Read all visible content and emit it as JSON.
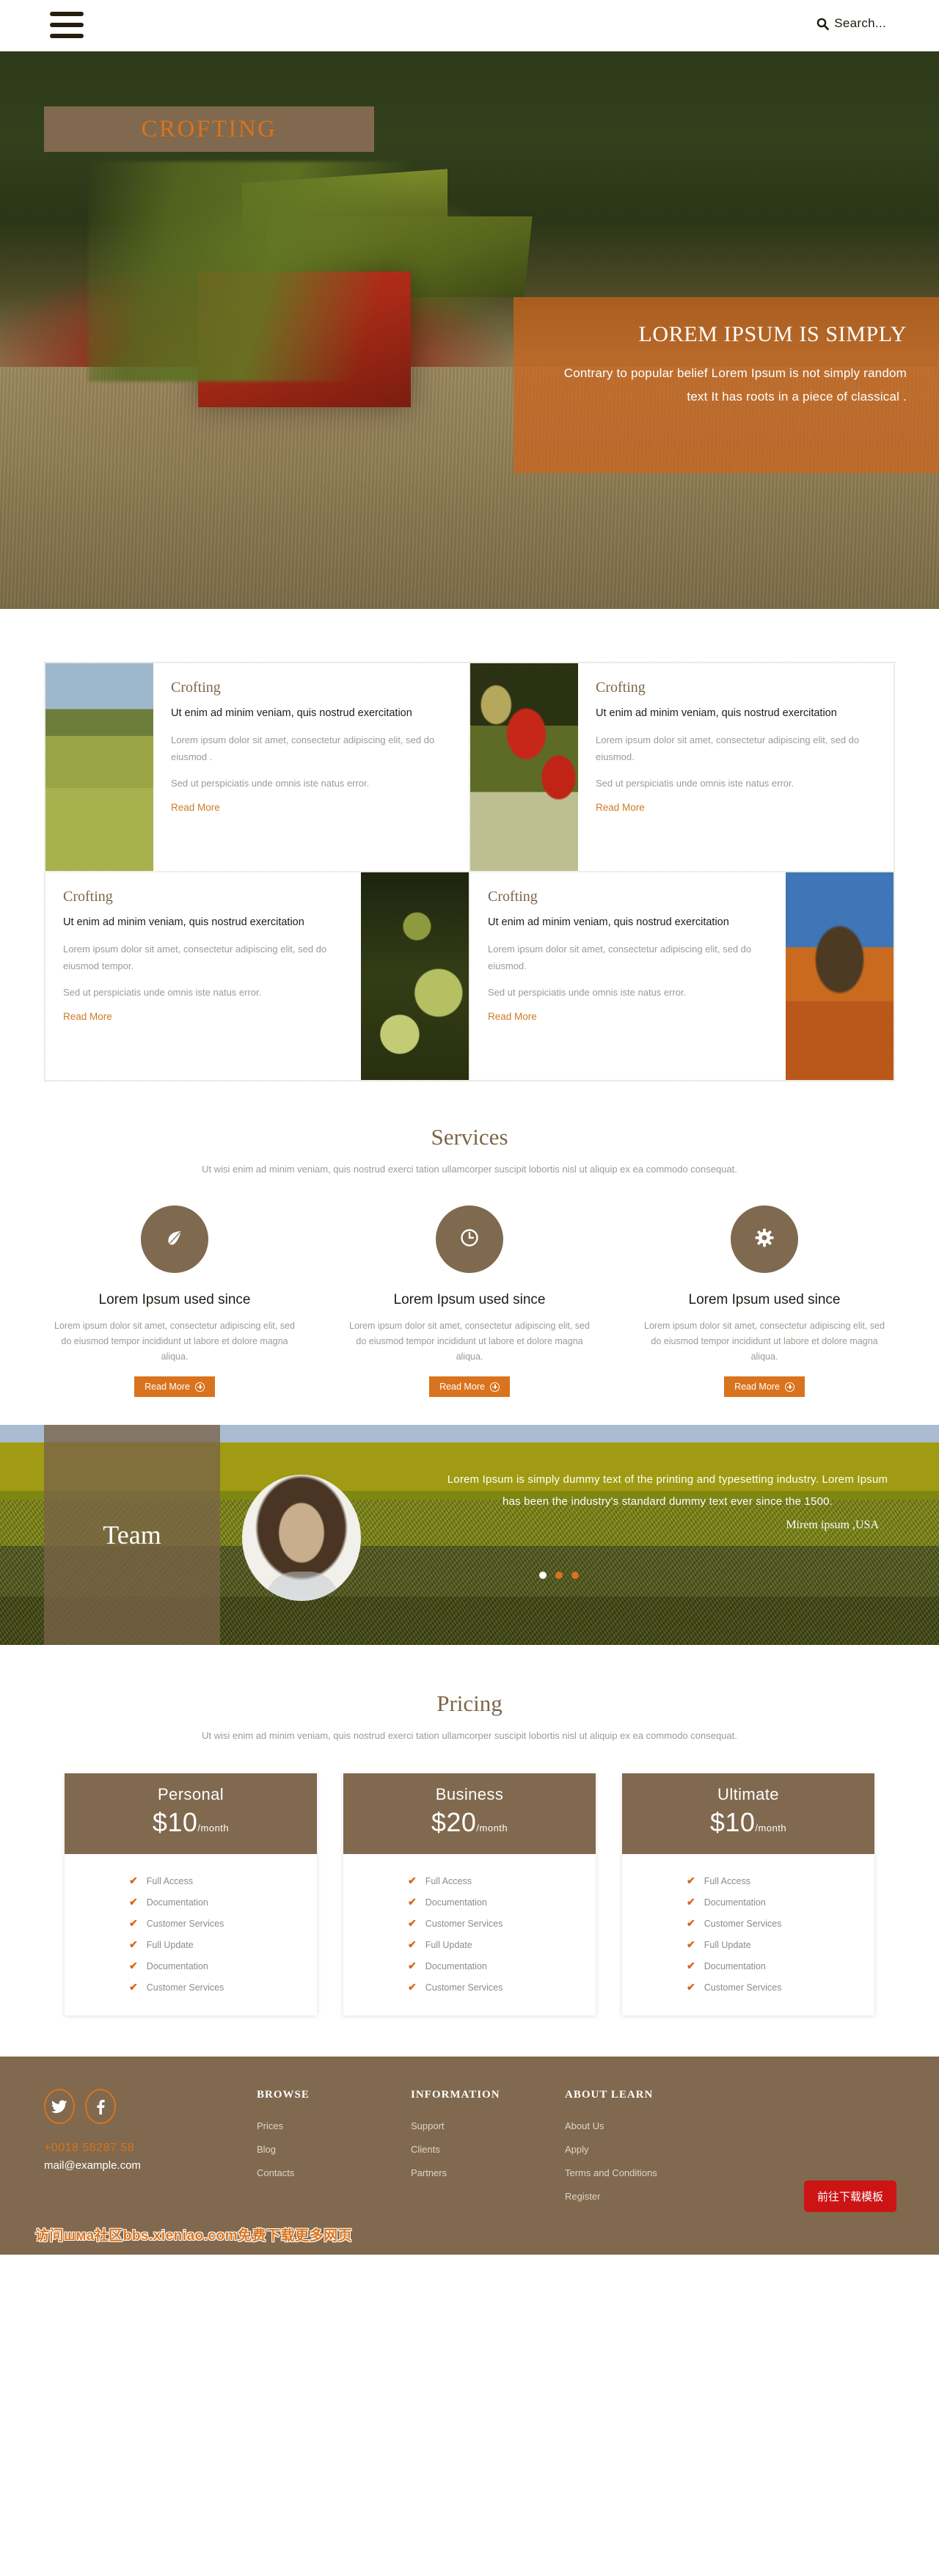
{
  "header": {
    "menu_icon": "hamburger-icon",
    "search_icon": "search-icon",
    "search_label": "Search...",
    "brand": "CROFTING"
  },
  "hero": {
    "title": "LOREM IPSUM IS SIMPLY",
    "paragraph": "Contrary to popular belief Lorem Ipsum is not simply random text It has roots in a piece of classical ."
  },
  "cards": [
    {
      "title": "Crofting",
      "subtitle": "Ut enim ad minim veniam, quis nostrud exercitation",
      "text1": "Lorem ipsum dolor sit amet, consectetur adipiscing elit, sed do eiusmod .",
      "text2": "Sed ut perspiciatis unde omnis iste natus error.",
      "link": "Read More",
      "image": "wheat-field-photo"
    },
    {
      "title": "Crofting",
      "subtitle": "Ut enim ad minim veniam, quis nostrud exercitation",
      "text1": "Lorem ipsum dolor sit amet, consectetur adipiscing elit, sed do eiusmod.",
      "text2": "Sed ut perspiciatis unde omnis iste natus error.",
      "link": "Read More",
      "image": "strawberries-photo"
    },
    {
      "title": "Crofting",
      "subtitle": "Ut enim ad minim veniam, quis nostrud exercitation",
      "text1": "Lorem ipsum dolor sit amet, consectetur adipiscing elit, sed do eiusmod tempor.",
      "text2": "Sed ut perspiciatis unde omnis iste natus error.",
      "link": "Read More",
      "image": "green-tomatoes-photo"
    },
    {
      "title": "Crofting",
      "subtitle": "Ut enim ad minim veniam, quis nostrud exercitation",
      "text1": "Lorem ipsum dolor sit amet, consectetur adipiscing elit, sed do eiusmod.",
      "text2": "Sed ut perspiciatis unde omnis iste natus error.",
      "link": "Read More",
      "image": "hay-bale-photo"
    }
  ],
  "services": {
    "title": "Services",
    "subtitle": "Ut wisi enim ad minim veniam, quis nostrud exerci tation ullamcorper suscipit lobortis nisl ut aliquip ex ea commodo consequat.",
    "items": [
      {
        "icon": "leaf-icon",
        "title": "Lorem Ipsum used since",
        "text": "Lorem ipsum dolor sit amet, consectetur adipiscing elit, sed do eiusmod tempor incididunt ut labore et dolore magna aliqua.",
        "button": "Read More"
      },
      {
        "icon": "clock-icon",
        "title": "Lorem Ipsum used since",
        "text": "Lorem ipsum dolor sit amet, consectetur adipiscing elit, sed do eiusmod tempor incididunt ut labore et dolore magna aliqua.",
        "button": "Read More"
      },
      {
        "icon": "gear-icon",
        "title": "Lorem Ipsum used since",
        "text": "Lorem ipsum dolor sit amet, consectetur adipiscing elit, sed do eiusmod tempor incididunt ut labore et dolore magna aliqua.",
        "button": "Read More"
      }
    ]
  },
  "team": {
    "title": "Team",
    "avatar": "team-member-photo",
    "quote": "Lorem Ipsum is simply dummy text of the printing and typesetting industry. Lorem Ipsum has been the industry's standard dummy text ever since the 1500.",
    "author": "Mirem ipsum ,USA",
    "dots": [
      "active",
      "inactive",
      "inactive"
    ]
  },
  "pricing": {
    "title": "Pricing",
    "subtitle": "Ut wisi enim ad minim veniam, quis nostrud exerci tation ullamcorper suscipit lobortis nisl ut aliquip ex ea commodo consequat.",
    "plans": [
      {
        "name": "Personal",
        "price": "$10",
        "per": "/month",
        "features": [
          "Full Access",
          "Documentation",
          "Customer Services",
          "Full Update",
          "Documentation",
          "Customer Services"
        ]
      },
      {
        "name": "Business",
        "price": "$20",
        "per": "/month",
        "features": [
          "Full Access",
          "Documentation",
          "Customer Services",
          "Full Update",
          "Documentation",
          "Customer Services"
        ]
      },
      {
        "name": "Ultimate",
        "price": "$10",
        "per": "/month",
        "features": [
          "Full Access",
          "Documentation",
          "Customer Services",
          "Full Update",
          "Documentation",
          "Customer Services"
        ]
      }
    ]
  },
  "footer": {
    "social": [
      {
        "icon": "twitter-icon"
      },
      {
        "icon": "facebook-icon"
      }
    ],
    "phone": "+0018 58287 58",
    "email": "mail@example.com",
    "columns": [
      {
        "heading": "BROWSE",
        "links": [
          "Prices",
          "Blog",
          "Contacts"
        ]
      },
      {
        "heading": "INFORMATION",
        "links": [
          "Support",
          "Clients",
          "Partners"
        ]
      },
      {
        "heading": "ABOUT LEARN",
        "links": [
          "About Us",
          "Apply",
          "Terms and Conditions",
          "Register"
        ]
      }
    ],
    "watermark": "访问шма社区bbs.xieniao.com免费下载更多网页",
    "download_button": "前往下载模板"
  },
  "colors": {
    "brand_brown": "#80694e",
    "accent_orange": "#d9731d",
    "title_brown": "#7d6649",
    "muted_text": "#9b9b93",
    "red_button": "#cc1414"
  }
}
